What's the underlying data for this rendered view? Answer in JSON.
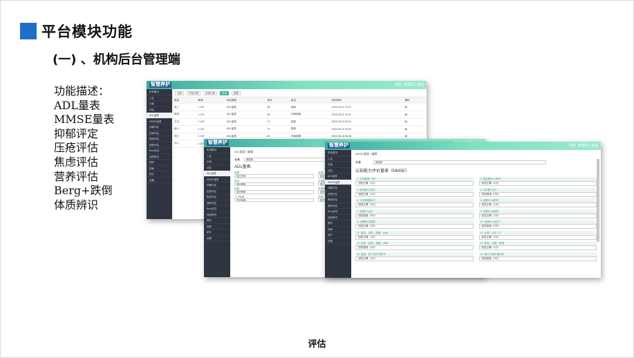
{
  "slide": {
    "title": "平台模块功能",
    "subtitle": "(一) 、机构后台管理端",
    "footer": "评估",
    "accent_color": "#1f6fc5"
  },
  "description": {
    "heading": "功能描述：",
    "items": [
      "ADL量表",
      "MMSE量表",
      "抑郁评定",
      "压疮评估",
      "焦虑评估",
      "营养评估",
      "Berg+跌倒",
      "体质辨识"
    ]
  },
  "screenshots": {
    "app_logo": "智慧养护",
    "header_user": "您好, 管理员 | 退出",
    "back": {
      "sidebar": [
        "机构概况",
        "入住",
        "长者",
        "评估",
        "ADL量表",
        "MMSE量表",
        "抑郁评定",
        "压疮评估",
        "焦虑评估",
        "营养评估",
        "Berg评估",
        "体质辨识",
        "照护",
        "档案",
        "统计",
        "设置"
      ],
      "filters": [
        "全部",
        "开始日期",
        "结束日期",
        "查询",
        "重置"
      ],
      "columns": [
        "姓名",
        "房间",
        "评估类型",
        "总分",
        "结论",
        "评估时间",
        "操作"
      ],
      "rows": [
        [
          "张三",
          "1-101",
          "ADL量表",
          "85",
          "轻度",
          "2023-05-11 10:15"
        ],
        [
          "李四",
          "1-102",
          "ADL量表",
          "65",
          "中度依赖",
          "2023-05-12 11:40"
        ],
        [
          "王五",
          "1-103",
          "ADL量表",
          "70",
          "轻度",
          "2023-05-13 09:22"
        ],
        [
          "赵六",
          "2-201",
          "ADL量表",
          "75",
          "轻度",
          "2023-05-15 16:05"
        ],
        [
          "钱七",
          "2-202",
          "ADL量表",
          "60",
          "中度依赖",
          "2023-05-16 08:48"
        ],
        [
          "孙八",
          "2-203",
          "ADL量表",
          "90",
          "正常",
          "2023-05-18 14:30"
        ]
      ]
    },
    "middle": {
      "breadcrumb": "ADL量表 / 编辑",
      "label": "长者",
      "value": "请选择",
      "form_title": "ADL量表",
      "questions": [
        "进餐",
        "洗澡",
        "修饰",
        "穿衣",
        "大便控制",
        "小便控制",
        "如厕",
        "床椅转移",
        "平地行走",
        "上下楼梯"
      ],
      "options": [
        "独立完成",
        "部分帮助",
        "完全依赖"
      ]
    },
    "front": {
      "breadcrumb": "MMSE量表 / 编辑",
      "label": "长者",
      "value": "请选择",
      "form_title": "认知能力评价量表（MMSE）",
      "questions": [
        "1. 今年是哪一年？",
        "2. 现在是什么季节？",
        "3. 现在是几月份？",
        "4. 今天是几号？",
        "5. 今天是星期几？",
        "6. 这是什么城市？",
        "7. 这是什么区？",
        "8. 这是什么医院？",
        "9. 这是第几层楼？",
        "10. 这是什么地方？",
        "11. 复述：皮球、国旗、树木",
        "12. 计算：100-7=？",
        "13. 回忆：皮球、国旗、树木",
        "14. 命名：手表、铅笔",
        "15. 复述：四十四只石狮子",
        "16. 按卡片指令做动作"
      ],
      "options": [
        "回答正确（1分）",
        "回答错误（0分）"
      ]
    }
  }
}
